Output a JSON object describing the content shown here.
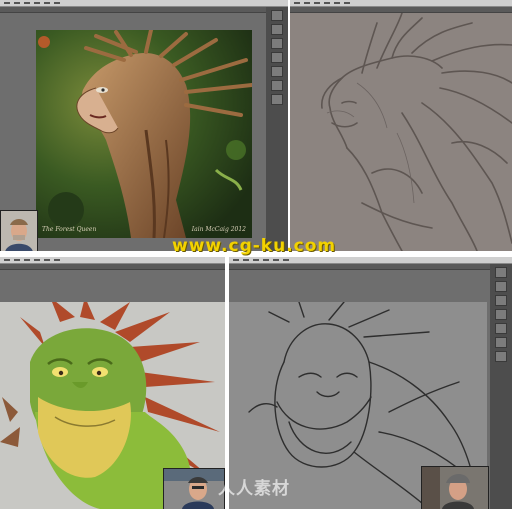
{
  "panels": {
    "top_left": {
      "signature_left": "The Forest Queen",
      "signature_right": "Iain McCaig 2012"
    },
    "top_right": {},
    "bottom_left": {},
    "bottom_right": {}
  },
  "watermarks": {
    "url": "www.cg-ku.com",
    "cn": "人人素材"
  },
  "colors": {
    "app_bg": "#6e6e6e",
    "dock_bg": "#4d4d4d",
    "sketch_bg": "#8c8480",
    "watermark_yellow": "#f2d200"
  }
}
